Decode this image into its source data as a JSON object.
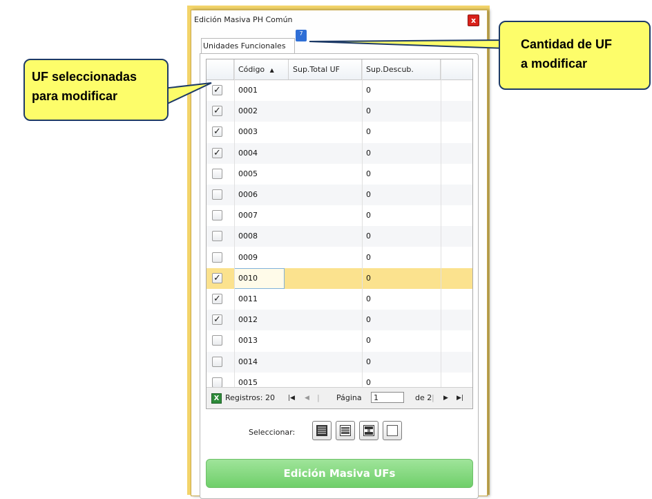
{
  "window": {
    "title": "Edición Masiva PH Común",
    "close_label": "x"
  },
  "tab": {
    "label": "Unidades Funcionales",
    "badge": "7"
  },
  "grid": {
    "columns": [
      "Código",
      "Sup.Total UF",
      "Sup.Descub."
    ],
    "sort_indicator": "▲",
    "rows": [
      {
        "codigo": "0001",
        "sup_total": "",
        "sup_descub": "0",
        "checked": true
      },
      {
        "codigo": "0002",
        "sup_total": "",
        "sup_descub": "0",
        "checked": true
      },
      {
        "codigo": "0003",
        "sup_total": "",
        "sup_descub": "0",
        "checked": true
      },
      {
        "codigo": "0004",
        "sup_total": "",
        "sup_descub": "0",
        "checked": true
      },
      {
        "codigo": "0005",
        "sup_total": "",
        "sup_descub": "0",
        "checked": false
      },
      {
        "codigo": "0006",
        "sup_total": "",
        "sup_descub": "0",
        "checked": false
      },
      {
        "codigo": "0007",
        "sup_total": "",
        "sup_descub": "0",
        "checked": false
      },
      {
        "codigo": "0008",
        "sup_total": "",
        "sup_descub": "0",
        "checked": false
      },
      {
        "codigo": "0009",
        "sup_total": "",
        "sup_descub": "0",
        "checked": false
      },
      {
        "codigo": "0010",
        "sup_total": "",
        "sup_descub": "0",
        "checked": true,
        "selected": true
      },
      {
        "codigo": "0011",
        "sup_total": "",
        "sup_descub": "0",
        "checked": true
      },
      {
        "codigo": "0012",
        "sup_total": "",
        "sup_descub": "0",
        "checked": true
      },
      {
        "codigo": "0013",
        "sup_total": "",
        "sup_descub": "0",
        "checked": false
      },
      {
        "codigo": "0014",
        "sup_total": "",
        "sup_descub": "0",
        "checked": false
      },
      {
        "codigo": "0015",
        "sup_total": "",
        "sup_descub": "0",
        "checked": false
      }
    ],
    "check_glyph": "✓"
  },
  "pager": {
    "registros_label": "Registros: 20",
    "first": "|◀",
    "prev": "◀",
    "pagina_label": "Página",
    "page_value": "1",
    "of_label": "de 2",
    "next": "▶",
    "last": "▶|"
  },
  "selection": {
    "label": "Seleccionar:"
  },
  "main_button": {
    "label": "Edición Masiva UFs"
  },
  "callouts": {
    "left": {
      "line1": "UF  seleccionadas",
      "line2": "para modificar"
    },
    "right": {
      "line1": "Cantidad  de  UF",
      "line2": "a modificar"
    }
  },
  "colors": {
    "accent": "#2f6fd6",
    "selected_row": "#fbe28e",
    "button_green": "#7ed679",
    "callout_fill": "#fdfd6a"
  }
}
